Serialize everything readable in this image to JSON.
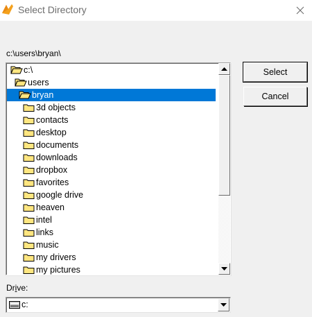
{
  "window": {
    "title": "Select Directory",
    "icon": "app-logo-icon",
    "close_icon": "close-icon"
  },
  "current_path": "c:\\users\\bryan\\",
  "tree": {
    "items": [
      {
        "label": "c:\\",
        "icon": "open-folder-icon",
        "level": 0,
        "selected": false
      },
      {
        "label": "users",
        "icon": "open-folder-icon",
        "level": 1,
        "selected": false
      },
      {
        "label": "bryan",
        "icon": "open-folder-icon",
        "level": 2,
        "selected": true
      },
      {
        "label": "3d objects",
        "icon": "folder-icon",
        "level": 3,
        "selected": false
      },
      {
        "label": "contacts",
        "icon": "folder-icon",
        "level": 3,
        "selected": false
      },
      {
        "label": "desktop",
        "icon": "folder-icon",
        "level": 3,
        "selected": false
      },
      {
        "label": "documents",
        "icon": "folder-icon",
        "level": 3,
        "selected": false
      },
      {
        "label": "downloads",
        "icon": "folder-icon",
        "level": 3,
        "selected": false
      },
      {
        "label": "dropbox",
        "icon": "folder-icon",
        "level": 3,
        "selected": false
      },
      {
        "label": "favorites",
        "icon": "folder-icon",
        "level": 3,
        "selected": false
      },
      {
        "label": "google drive",
        "icon": "folder-icon",
        "level": 3,
        "selected": false
      },
      {
        "label": "heaven",
        "icon": "folder-icon",
        "level": 3,
        "selected": false
      },
      {
        "label": "intel",
        "icon": "folder-icon",
        "level": 3,
        "selected": false
      },
      {
        "label": "links",
        "icon": "folder-icon",
        "level": 3,
        "selected": false
      },
      {
        "label": "music",
        "icon": "folder-icon",
        "level": 3,
        "selected": false
      },
      {
        "label": "my drivers",
        "icon": "folder-icon",
        "level": 3,
        "selected": false
      },
      {
        "label": "my pictures",
        "icon": "folder-icon",
        "level": 3,
        "selected": false
      }
    ]
  },
  "buttons": {
    "select_label": "Select",
    "cancel_label": "Cancel"
  },
  "drive": {
    "label_prefix": "Dr",
    "label_accel": "i",
    "label_suffix": "ve:",
    "value": "c:",
    "icon": "drive-icon"
  },
  "colors": {
    "selection": "#0078d7",
    "folder_fill": "#ffe680",
    "window_bg": "#f0f0f0"
  }
}
